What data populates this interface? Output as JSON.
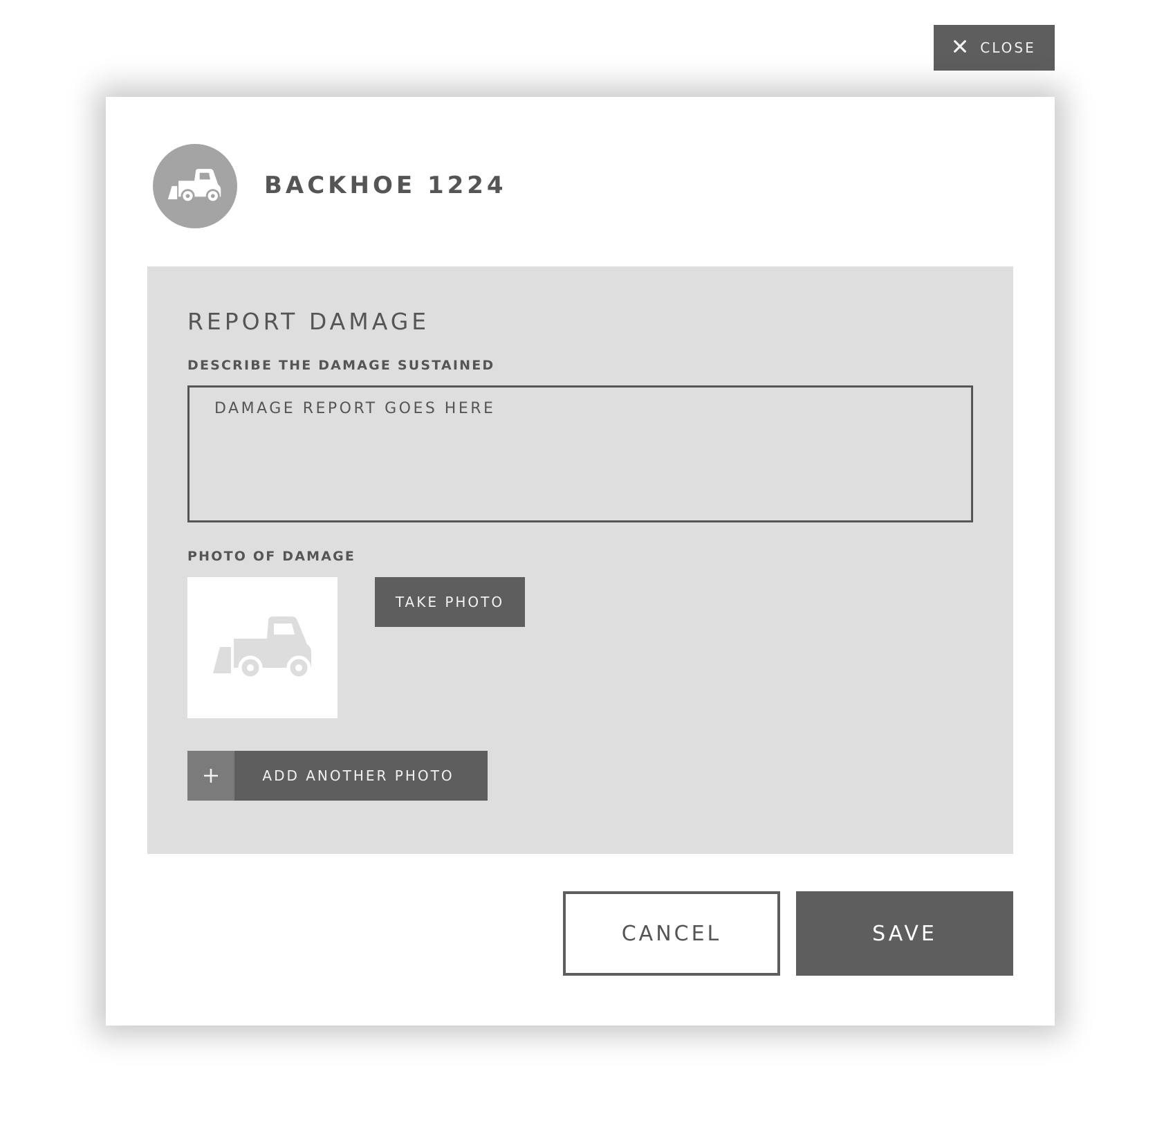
{
  "close": {
    "label": "CLOSE",
    "icon": "close-icon"
  },
  "header": {
    "title": "BACKHOE 1224",
    "avatar_icon": "backhoe-icon"
  },
  "report": {
    "title": "REPORT DAMAGE",
    "description_label": "DESCRIBE THE DAMAGE SUSTAINED",
    "description_placeholder": "DAMAGE REPORT GOES HERE",
    "photo_label": "PHOTO OF DAMAGE",
    "photo_placeholder_icon": "backhoe-icon",
    "take_photo_label": "TAKE PHOTO",
    "add_photo_label": "ADD ANOTHER PHOTO",
    "add_icon": "plus-icon"
  },
  "actions": {
    "cancel_label": "CANCEL",
    "save_label": "SAVE"
  },
  "colors": {
    "button_dark": "#5e5e5e",
    "panel_bg": "#dedede",
    "text": "#555555",
    "avatar_bg": "#a4a4a4"
  }
}
